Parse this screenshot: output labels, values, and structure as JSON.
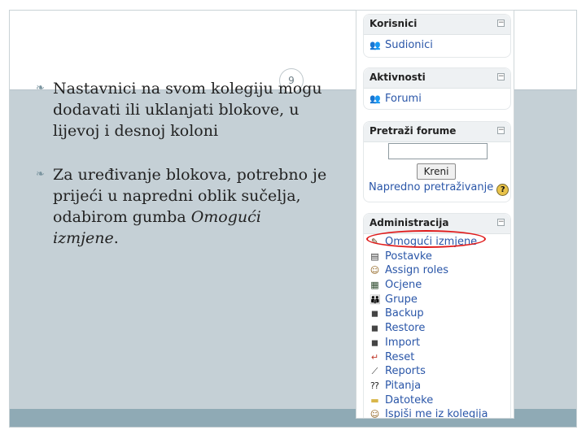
{
  "slide": {
    "number": "9",
    "bullets": [
      {
        "text": "Nastavnici na svom kolegiju mogu dodavati ili uklanjati blokove, u lijevoj i desnoj koloni"
      },
      {
        "text_prefix": "Za uređivanje blokova, potrebno je prijeći u napredni oblik sučelja, odabirom gumba ",
        "text_emph": "Omogući izmjene",
        "text_suffix": "."
      }
    ],
    "colors": {
      "body_bg": "#c5d0d6",
      "footer_bar": "#8faab5",
      "annotation": "#e01b1b"
    }
  },
  "moodle": {
    "blocks": [
      {
        "title": "Korisnici",
        "items": [
          {
            "label": "Sudionici",
            "icon": "users-icon"
          }
        ]
      },
      {
        "title": "Aktivnosti",
        "items": [
          {
            "label": "Forumi",
            "icon": "forum-icon"
          }
        ]
      },
      {
        "title": "Pretraži forume",
        "button": "Kreni",
        "advanced": "Napredno pretraživanje",
        "help": "?"
      },
      {
        "title": "Administracija",
        "items": [
          {
            "label": "Omogući izmjene",
            "icon": "edit-icon"
          },
          {
            "label": "Postavke",
            "icon": "settings-icon"
          },
          {
            "label": "Assign roles",
            "icon": "roles-icon"
          },
          {
            "label": "Ocjene",
            "icon": "grades-icon"
          },
          {
            "label": "Grupe",
            "icon": "groups-icon"
          },
          {
            "label": "Backup",
            "icon": "backup-icon"
          },
          {
            "label": "Restore",
            "icon": "restore-icon"
          },
          {
            "label": "Import",
            "icon": "import-icon"
          },
          {
            "label": "Reset",
            "icon": "reset-icon"
          },
          {
            "label": "Reports",
            "icon": "reports-icon"
          },
          {
            "label": "Pitanja",
            "icon": "questions-icon"
          },
          {
            "label": "Datoteke",
            "icon": "folder-icon"
          },
          {
            "label": "Ispiši me iz kolegija",
            "icon": "unenrol-icon"
          }
        ]
      }
    ],
    "hide_symbol": "−",
    "colors": {
      "link": "#2a56a8",
      "header_bg": "#eef1f3"
    }
  }
}
